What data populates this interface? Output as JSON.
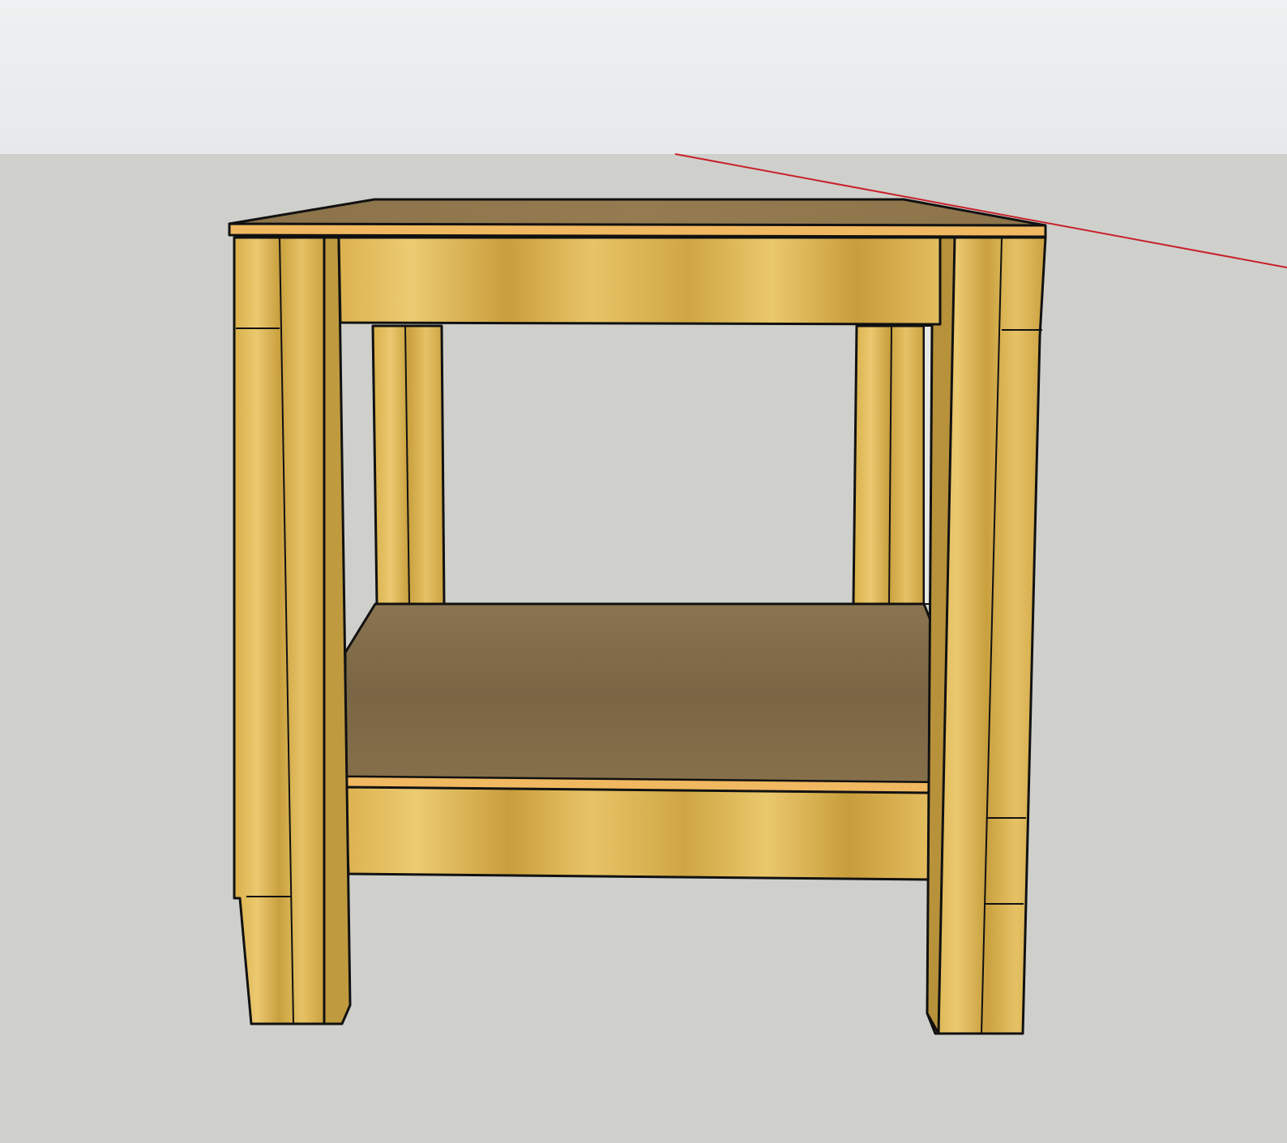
{
  "window": {
    "title": ""
  },
  "viewport": {
    "sky_color": "#e8eaec",
    "ground_color": "#cfd0cc",
    "red_axis_color": "#c8202a",
    "edge_color": "#111111",
    "model": {
      "name": "end-table",
      "parts": [
        {
          "name": "top-panel",
          "role": "tabletop"
        },
        {
          "name": "front-apron",
          "role": "rail"
        },
        {
          "name": "lower-rail",
          "role": "rail"
        },
        {
          "name": "lower-shelf",
          "role": "shelf"
        },
        {
          "name": "leg-front-left",
          "role": "leg"
        },
        {
          "name": "leg-front-right",
          "role": "leg"
        },
        {
          "name": "leg-back-left",
          "role": "leg"
        },
        {
          "name": "leg-back-right",
          "role": "leg"
        }
      ],
      "wood_colors": {
        "light": "#e9c66a",
        "mid": "#d1a842",
        "dark": "#a7812c",
        "top_surface": "#8e7549",
        "top_edge": "#f0b860",
        "shelf_surface": "#7e6a49"
      }
    }
  }
}
